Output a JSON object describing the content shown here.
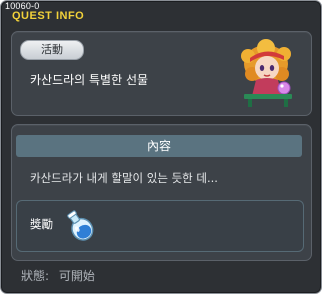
{
  "quest_id": "10060-0",
  "title": "QUEST INFO",
  "activity_badge": "活動",
  "quest_name": "카산드라의 특별한 선물",
  "npc": {
    "icon": "cassandra-npc-portrait"
  },
  "content": {
    "header": "內容",
    "text": "카산드라가 내게 할말이 있는 듯한 데..."
  },
  "reward": {
    "label": "獎勵",
    "item_icon": "potion-icon"
  },
  "status": {
    "label": "狀態:",
    "value": "可開始"
  },
  "colors": {
    "title": "#f2d23a",
    "window_bg": "#2d3034",
    "panel_bg": "#3d4248",
    "header_bg": "#5a7380"
  }
}
